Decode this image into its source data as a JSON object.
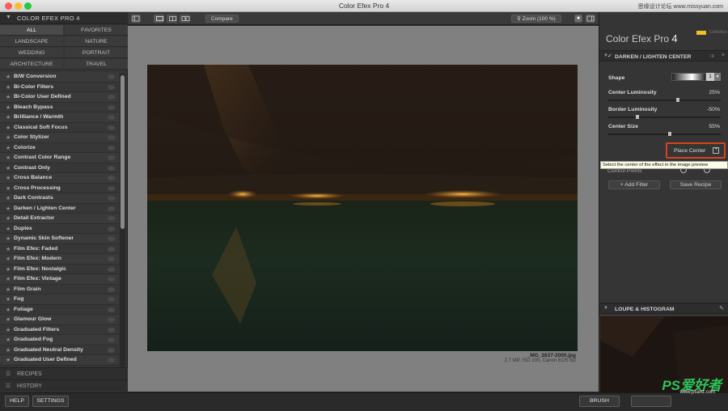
{
  "window": {
    "title": "Color Efex Pro 4",
    "watermark": "思缘设计论坛 www.missyuan.com"
  },
  "left_panel": {
    "title": "COLOR EFEX PRO 4",
    "categories": [
      "ALL",
      "FAVORITES",
      "LANDSCAPE",
      "NATURE",
      "WEDDING",
      "PORTRAIT",
      "ARCHITECTURE",
      "TRAVEL"
    ],
    "selected_category": "ALL",
    "filters": [
      "B/W Conversion",
      "Bi-Color Filters",
      "Bi-Color User Defined",
      "Bleach Bypass",
      "Brilliance / Warmth",
      "Classical Soft Focus",
      "Color Stylizer",
      "Colorize",
      "Contrast Color Range",
      "Contrast Only",
      "Cross Balance",
      "Cross Processing",
      "Dark Contrasts",
      "Darken / Lighten Center",
      "Detail Extractor",
      "Duplex",
      "Dynamic Skin Softener",
      "Film Efex: Faded",
      "Film Efex: Modern",
      "Film Efex: Nostalgic",
      "Film Efex: Vintage",
      "Film Grain",
      "Fog",
      "Foliage",
      "Glamour Glow",
      "Graduated Filters",
      "Graduated Fog",
      "Graduated Neutral Density",
      "Graduated User Defined"
    ],
    "sections": {
      "recipes": "RECIPES",
      "history": "HISTORY"
    }
  },
  "toolbar": {
    "compare_label": "Compare",
    "zoom_label": "Zoom (100 %)"
  },
  "photo": {
    "filename": "_MG_2637-2000.jpg",
    "info": "2.7 MP, ISO 100, Canon EOS 6D"
  },
  "right_panel": {
    "brand": "Color Efex Pro",
    "brand_version": "4",
    "collection_label": "Collection",
    "filter_title": "DARKEN / LIGHTEN CENTER",
    "shape_label": "Shape",
    "shape_value": "1",
    "controls": [
      {
        "label": "Center Luminosity",
        "value": "25%",
        "level": 0.625
      },
      {
        "label": "Border Luminosity",
        "value": "-50%",
        "level": 0.25
      },
      {
        "label": "Center Size",
        "value": "55%",
        "level": 0.55
      }
    ],
    "place_center_label": "Place Center",
    "tooltip": "Select the center of the effect in the image preview",
    "control_points_label": "Control Points",
    "add_filter_label": "Add Filter",
    "save_recipe_label": "Save Recipe",
    "loupe_title": "LOUPE & HISTOGRAM"
  },
  "bottom": {
    "help_label": "HELP",
    "settings_label": "SETTINGS",
    "brush_label": "BRUSH",
    "watermark_logo": "PS爱好者",
    "watermark_url": "www.psahz.com"
  },
  "colors": {
    "highlight_border": "#d8431f",
    "traffic_close": "#fc5f57",
    "traffic_min": "#fdbc2e",
    "traffic_max": "#28c840"
  }
}
